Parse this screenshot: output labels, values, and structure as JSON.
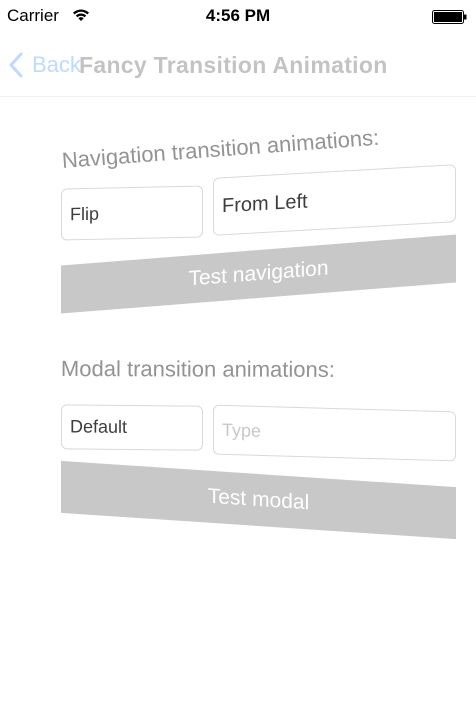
{
  "status_bar": {
    "carrier": "Carrier",
    "time": "4:56 PM"
  },
  "nav": {
    "back_label": "Back",
    "title": "Fancy Transition Animation"
  },
  "navigation_section": {
    "title": "Navigation transition animations:",
    "animation_field": {
      "value": "Flip",
      "placeholder": ""
    },
    "direction_field": {
      "value": "From Left",
      "placeholder": ""
    },
    "button_label": "Test navigation"
  },
  "modal_section": {
    "title": "Modal transition animations:",
    "animation_field": {
      "value": "Default",
      "placeholder": ""
    },
    "type_field": {
      "value": "",
      "placeholder": "Type"
    },
    "button_label": "Test modal"
  },
  "colors": {
    "accent": "#1a7cf5",
    "button_bg": "#c6c6c6",
    "section_text": "#8e8e8e"
  }
}
